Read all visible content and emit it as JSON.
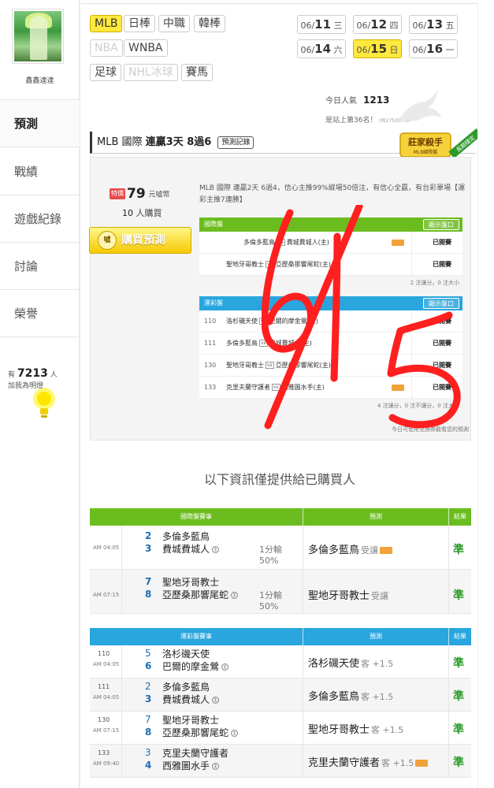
{
  "sidebar": {
    "username": "鑫鑫達達",
    "nav": [
      "預測",
      "戰績",
      "遊戲紀錄",
      "討論",
      "榮譽"
    ],
    "likes_prefix": "有",
    "likes_count": "7213",
    "likes_suffix": "人",
    "likes_sub": "加我為明燈"
  },
  "categories": {
    "row1": [
      "MLB",
      "日棒",
      "中職",
      "韓棒"
    ],
    "row2": [
      "NBA",
      "WNBA"
    ],
    "row3": [
      "足球",
      "NHL冰球",
      "賽馬"
    ]
  },
  "dates": [
    {
      "d": "06/",
      "n": "11",
      "w": "三"
    },
    {
      "d": "06/",
      "n": "12",
      "w": "四"
    },
    {
      "d": "06/",
      "n": "13",
      "w": "五"
    },
    {
      "d": "06/",
      "n": "14",
      "w": "六"
    },
    {
      "d": "06/",
      "n": "15",
      "w": "日"
    },
    {
      "d": "06/",
      "n": "16",
      "w": "一"
    }
  ],
  "stats": {
    "popularity_label": "今日人氣",
    "popularity_value": "1213",
    "rank_text": "是站上第36名！",
    "rank_sub": "(共27530人)"
  },
  "header": {
    "prefix": "MLB 國際 ",
    "highlight": "連贏3天 8過6",
    "history_btn": "預測記錄"
  },
  "badge": {
    "title": "莊家殺手",
    "sub": "MLB國際盤",
    "ribbon": "長期穩定"
  },
  "card": {
    "price_tag": "特價",
    "price": "79",
    "price_unit": "元噓幣",
    "buyers_count": "10",
    "buyers_label": "人購買",
    "buy_label": "購買預測",
    "buy_icon": "噓",
    "description": "MLB 國際 連贏2天 6過4，信心主推99%縱場50倍注，有信心全贏，有台彩單場【運彩主推7連勝】",
    "intl": {
      "title": "國際盤",
      "show": "顯示盤口",
      "rows": [
        {
          "code": "",
          "away": "多倫多藍鳥",
          "vs": "vs",
          "home": "費城費城人(主)",
          "status": "已開賽"
        },
        {
          "code": "",
          "away": "聖地牙哥教士",
          "vs": "vs",
          "home": "亞歷桑那響尾蛇(主)",
          "status": "已開賽"
        }
      ],
      "summary": "2 注讓分，0 注大小"
    },
    "lottery": {
      "title": "運彩盤",
      "show": "顯示盤口",
      "rows": [
        {
          "code": "110",
          "away": "洛杉磯天使",
          "vs": "vs",
          "home": "巴爾的摩金鶯(主)",
          "status": "已開賽"
        },
        {
          "code": "111",
          "away": "多倫多藍鳥",
          "vs": "vs",
          "home": "費城費城人(主)",
          "status": "已開賽"
        },
        {
          "code": "130",
          "away": "聖地牙哥教士",
          "vs": "vs",
          "home": "亞歷桑那響尾蛇(主)",
          "status": "已開賽"
        },
        {
          "code": "133",
          "away": "克里夫蘭守護者",
          "vs": "vs",
          "home": "西雅圖水手(主)",
          "status": "已開賽"
        }
      ],
      "summary": "4 注讓分，0 注不讓分，0 注大小",
      "footer": "今日可使用兌換券觀看您的預測"
    }
  },
  "notice": "以下資訊僅提供給已購買人",
  "intl_results": {
    "headers": [
      "國際盤賽事",
      "預測",
      "結果"
    ],
    "rows": [
      {
        "time": "AM 04:05",
        "n1": "2",
        "t1": "多倫多藍鳥",
        "n2": "3",
        "t2": "費城費城人",
        "home": "主",
        "odds1": "1分輸",
        "odds2": "50%",
        "pick": "多倫多藍鳥",
        "hc": "受讓",
        "result": "準"
      },
      {
        "time": "AM 07:15",
        "n1": "7",
        "t1": "聖地牙哥教士",
        "n2": "8",
        "t2": "亞歷桑那響尾蛇",
        "home": "主",
        "odds1": "1分輸",
        "odds2": "50%",
        "pick": "聖地牙哥教士",
        "hc": "受讓",
        "result": "準"
      }
    ]
  },
  "lottery_results": {
    "headers": [
      "運彩盤賽事",
      "預測",
      "結果"
    ],
    "rows": [
      {
        "code": "110",
        "time": "AM 04:05",
        "n1": "5",
        "t1": "洛杉磯天使",
        "n2": "6",
        "t2": "巴爾的摩金鶯",
        "home": "主",
        "pick": "洛杉磯天使",
        "hc": "客 +1.5",
        "result": "準"
      },
      {
        "code": "111",
        "time": "AM 04:05",
        "n1": "2",
        "t1": "多倫多藍鳥",
        "n2": "3",
        "t2": "費城費城人",
        "home": "主",
        "pick": "多倫多藍鳥",
        "hc": "客 +1.5",
        "result": "準"
      },
      {
        "code": "130",
        "time": "AM 07:15",
        "n1": "7",
        "t1": "聖地牙哥教士",
        "n2": "8",
        "t2": "亞歷桑那響尾蛇",
        "home": "主",
        "pick": "聖地牙哥教士",
        "hc": "客 +1.5",
        "result": "準"
      },
      {
        "code": "133",
        "time": "AM 09:40",
        "n1": "3",
        "t1": "克里夫蘭守護者",
        "n2": "4",
        "t2": "西雅圖水手",
        "home": "主",
        "pick": "克里夫蘭守護者",
        "hc": "客 +1.5",
        "result": "準"
      }
    ]
  },
  "colors": {
    "accent_yellow": "#ffe93d",
    "table_green": "#6bbd1f",
    "table_blue": "#29a6de",
    "scribble_red": "#ff1f1f",
    "result_green": "#2e9a2e"
  }
}
